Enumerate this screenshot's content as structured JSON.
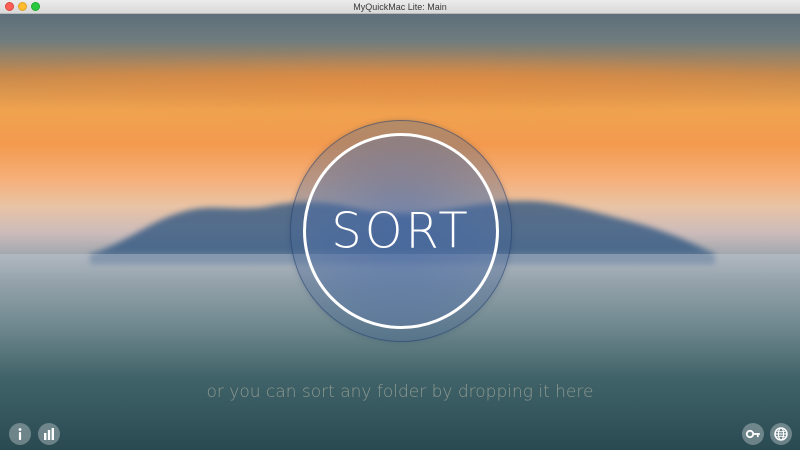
{
  "window": {
    "title": "MyQuickMac Lite: Main"
  },
  "main": {
    "sort_label": "SORT",
    "drop_hint": "or you can sort any folder by dropping it here"
  },
  "footer": {
    "left_icons": [
      "info-icon",
      "stats-icon"
    ],
    "right_icons": [
      "key-icon",
      "globe-icon"
    ]
  },
  "colors": {
    "ring": "#ffffff",
    "sunset_orange": "#f39a4f",
    "water_teal": "#3f6268"
  }
}
